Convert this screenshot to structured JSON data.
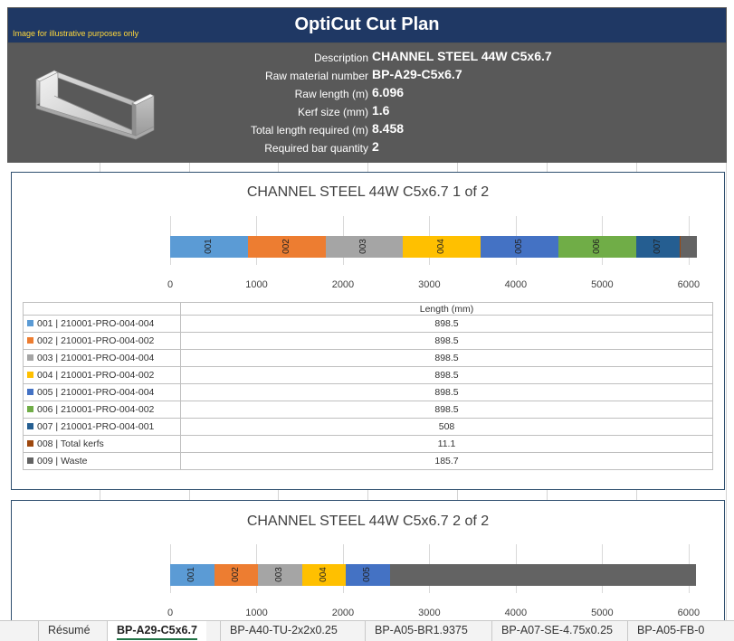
{
  "header": {
    "title": "OptiCut Cut Plan",
    "note": "Image for illustrative purposes only"
  },
  "info": [
    {
      "label": "Description",
      "value": "CHANNEL STEEL 44W C5x6.7"
    },
    {
      "label": "Raw material number",
      "value": "BP-A29-C5x6.7"
    },
    {
      "label": "Raw length (m)",
      "value": "6.096"
    },
    {
      "label": "Kerf size (mm)",
      "value": "1.6"
    },
    {
      "label": "Total length required (m)",
      "value": "8.458"
    },
    {
      "label": "Required bar quantity",
      "value": "2"
    }
  ],
  "colors": {
    "001": "#5b9bd5",
    "002": "#ed7d31",
    "003": "#a5a5a5",
    "004": "#ffc000",
    "005": "#4472c4",
    "006": "#70ad47",
    "007": "#255e91",
    "008": "#9e480e",
    "009": "#636363"
  },
  "chart_data": [
    {
      "type": "bar",
      "title": "CHANNEL STEEL 44W C5x6.7   1 of 2",
      "orientation": "horizontal-stacked",
      "xlim": [
        0,
        6000
      ],
      "xticks": [
        "0",
        "1000",
        "2000",
        "3000",
        "4000",
        "5000",
        "6000"
      ],
      "xlabel": "Length  (mm)",
      "series": [
        {
          "name": "001  | 210001-PRO-004-004",
          "code": "001",
          "value": 898.5
        },
        {
          "name": "002  | 210001-PRO-004-002",
          "code": "002",
          "value": 898.5
        },
        {
          "name": "003  | 210001-PRO-004-004",
          "code": "003",
          "value": 898.5
        },
        {
          "name": "004  | 210001-PRO-004-002",
          "code": "004",
          "value": 898.5
        },
        {
          "name": "005  | 210001-PRO-004-004",
          "code": "005",
          "value": 898.5
        },
        {
          "name": "006  | 210001-PRO-004-002",
          "code": "006",
          "value": 898.5
        },
        {
          "name": "007  | 210001-PRO-004-001",
          "code": "007",
          "value": 508
        },
        {
          "name": "008  | Total kerfs",
          "code": "008",
          "value": 11.1
        },
        {
          "name": "009  | Waste",
          "code": "009",
          "value": 185.7
        }
      ],
      "table": [
        {
          "label": "001  | 210001-PRO-004-004",
          "code": "001",
          "value": "898.5"
        },
        {
          "label": "002  | 210001-PRO-004-002",
          "code": "002",
          "value": "898.5"
        },
        {
          "label": "003  | 210001-PRO-004-004",
          "code": "003",
          "value": "898.5"
        },
        {
          "label": "004  | 210001-PRO-004-002",
          "code": "004",
          "value": "898.5"
        },
        {
          "label": "005  | 210001-PRO-004-004",
          "code": "005",
          "value": "898.5"
        },
        {
          "label": "006  | 210001-PRO-004-002",
          "code": "006",
          "value": "898.5"
        },
        {
          "label": "007  | 210001-PRO-004-001",
          "code": "007",
          "value": "508"
        },
        {
          "label": "008  | Total kerfs",
          "code": "008",
          "value": "11.1"
        },
        {
          "label": "009  | Waste",
          "code": "009",
          "value": "185.7"
        }
      ]
    },
    {
      "type": "bar",
      "title": "CHANNEL STEEL 44W C5x6.7   2 of 2",
      "orientation": "horizontal-stacked",
      "xlim": [
        0,
        6000
      ],
      "xticks": [
        "0",
        "1000",
        "2000",
        "3000",
        "4000",
        "5000",
        "6000"
      ],
      "series": [
        {
          "code": "001",
          "value": 508
        },
        {
          "code": "002",
          "value": 508
        },
        {
          "code": "003",
          "value": 508
        },
        {
          "code": "004",
          "value": 508
        },
        {
          "code": "005",
          "value": 508
        },
        {
          "code": "009",
          "value": 3550
        }
      ]
    }
  ],
  "tabs": [
    {
      "label": "Résumé",
      "active": false
    },
    {
      "label": "BP-A29-C5x6.7",
      "active": true
    },
    {
      "label": "BP-A40-TU-2x2x0.25",
      "active": false
    },
    {
      "label": "BP-A05-BR1.9375",
      "active": false
    },
    {
      "label": "BP-A07-SE-4.75x0.25",
      "active": false
    },
    {
      "label": "BP-A05-FB-0",
      "active": false
    }
  ]
}
